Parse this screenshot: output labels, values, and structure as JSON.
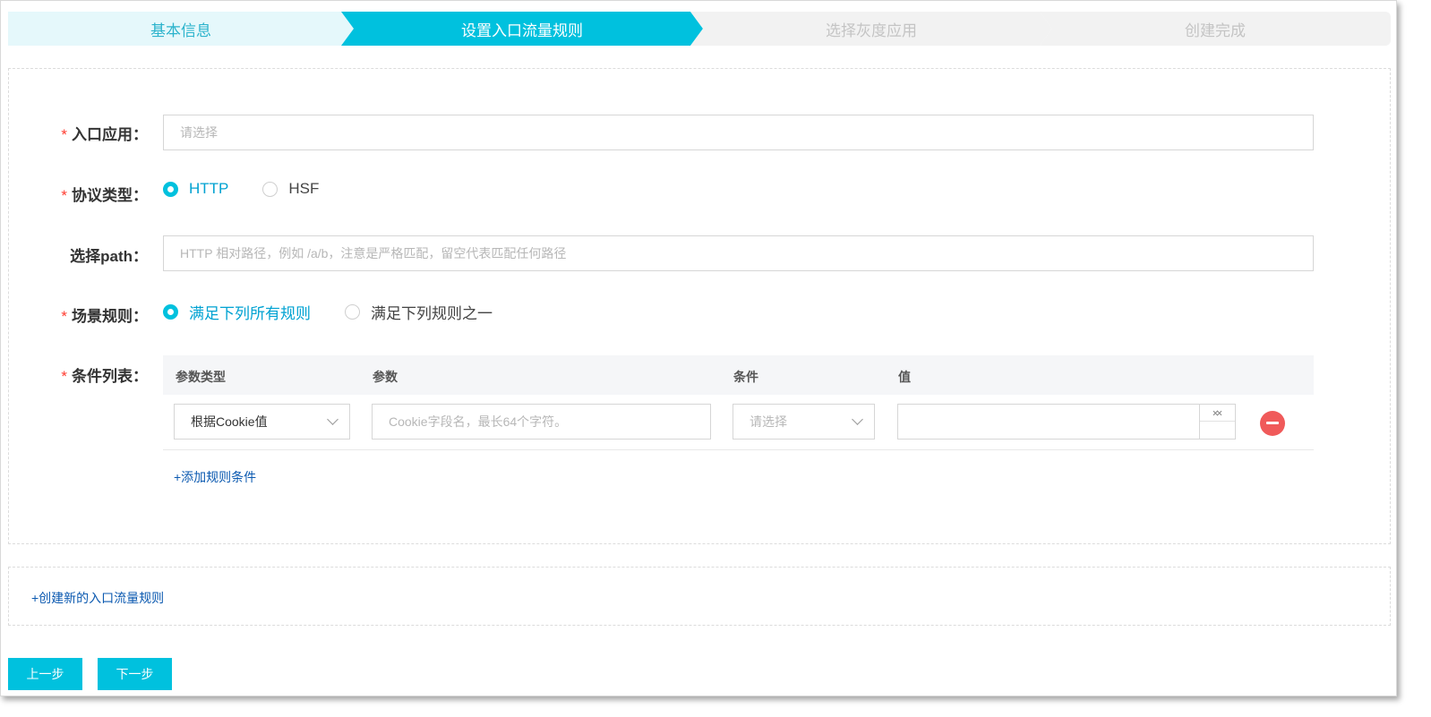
{
  "steps": [
    {
      "label": "基本信息",
      "state": "done"
    },
    {
      "label": "设置入口流量规则",
      "state": "active"
    },
    {
      "label": "选择灰度应用",
      "state": "pending"
    },
    {
      "label": "创建完成",
      "state": "pending"
    }
  ],
  "form": {
    "required_mark": "*",
    "entry_app": {
      "label": "入口应用：",
      "placeholder": "请选择"
    },
    "protocol": {
      "label": "协议类型：",
      "options": [
        "HTTP",
        "HSF"
      ],
      "selected": "HTTP"
    },
    "path": {
      "label": "选择path：",
      "placeholder": "HTTP 相对路径，例如 /a/b，注意是严格匹配，留空代表匹配任何路径"
    },
    "scene": {
      "label": "场景规则：",
      "options": [
        "满足下列所有规则",
        "满足下列规则之一"
      ],
      "selected": "满足下列所有规则"
    },
    "conditions": {
      "label": "条件列表：",
      "headers": [
        "参数类型",
        "参数",
        "条件",
        "值"
      ],
      "rows": [
        {
          "param_type": "根据Cookie值",
          "param_placeholder": "Cookie字段名，最长64个字符。",
          "condition_placeholder": "请选择",
          "value": ""
        }
      ],
      "add_link": "+添加规则条件"
    }
  },
  "add_rule_link": "+创建新的入口流量规则",
  "buttons": {
    "prev": "上一步",
    "next": "下一步"
  },
  "colors": {
    "accent": "#00c1de",
    "danger": "#f05a5a",
    "link": "#0b59b0"
  }
}
